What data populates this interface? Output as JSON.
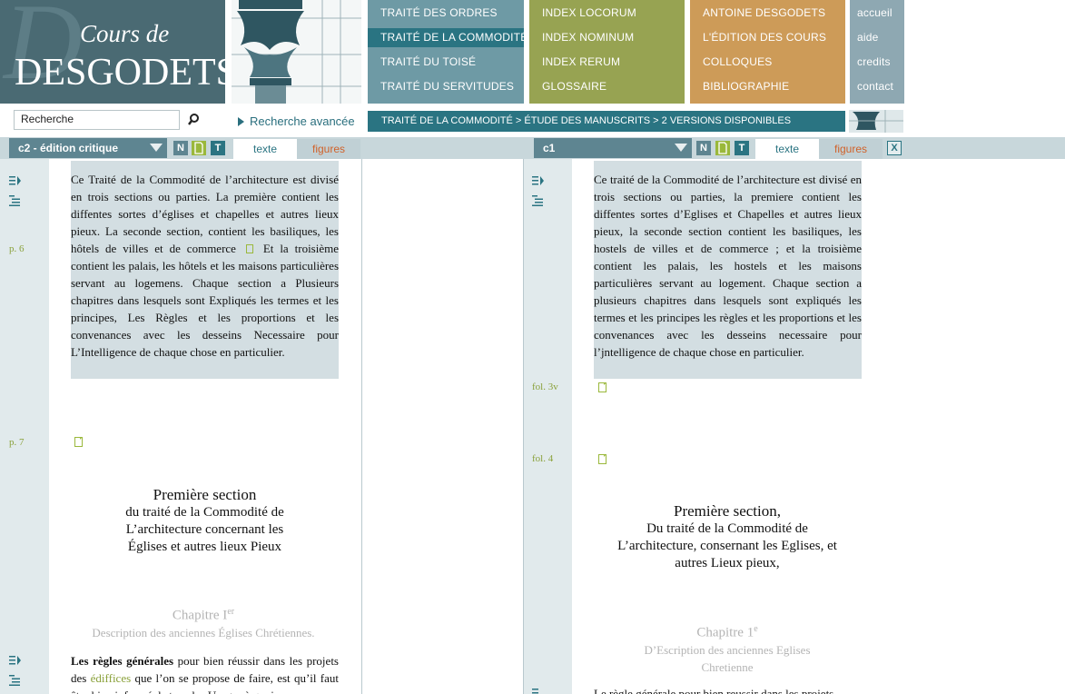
{
  "logo": {
    "line1": "Cours de",
    "line2": "DESGODETS",
    "bg_letter": "D"
  },
  "menu": {
    "col1": [
      "TRAITÉ DES ORDRES",
      "TRAITÉ DE LA COMMODITÉ",
      "TRAITÉ DU TOISÉ",
      "TRAITÉ DU SERVITUDES"
    ],
    "col2": [
      "INDEX LOCORUM",
      "INDEX NOMINUM",
      "INDEX RERUM",
      "GLOSSAIRE"
    ],
    "col3": [
      "ANTOINE DESGODETS",
      "L'ÉDITION DES COURS",
      "COLLOQUES",
      "BIBLIOGRAPHIE"
    ],
    "col4": [
      "accueil",
      "aide",
      "credits",
      "contact"
    ],
    "active": "TRAITÉ DE LA COMMODITÉ"
  },
  "search": {
    "value": "Recherche",
    "advanced": "Recherche avancée"
  },
  "breadcrumb": "TRAITÉ DE LA COMMODITÉ > ÉTUDE DES MANUSCRITS > 2 VERSIONS DISPONIBLES",
  "colors": {
    "teal": "#2a7482",
    "olive": "#97a352",
    "ochre": "#cd9b58",
    "grey_blue": "#8ea8b2",
    "green_label": "#8aa13a",
    "orange_tab": "#d0622a"
  },
  "left_panel": {
    "version": "c2 - édition critique",
    "btn_n": "N",
    "btn_t": "T",
    "tab_text": "texte",
    "tab_figures": "figures",
    "para1_a": "Ce Traité de la Commodité de l’architecture est divisé en trois sections ou parties. La première contient les diffentes sortes d’églises et chapelles et autres lieux pieux. La seconde section, contient les basiliques, les hôtels de villes et de commerce",
    "para1_b": "Et la troisième contient les palais, les hôtels et les maisons particulières servant au logemens. Chaque section a Plusieurs chapitres dans lesquels sont Expliqués les termes et les principes, Les Règles et les proportions et les convenances avec les desseins Necessaire pour L’Intelligence de chaque chose en particulier.",
    "page1": "p. 6",
    "page2": "p. 7",
    "section_title": "Première section",
    "section_sub1": "du traité de la Commodité de",
    "section_sub2": "L’architecture concernant les",
    "section_sub3": "Églises et autres lieux Pieux",
    "chapter": "Chapitre I",
    "chapter_sup": "er",
    "chapter_sub": "Description des anciennes Églises Chrétiennes.",
    "para2_bold": "Les règles générales",
    "para2_a": "pour bien réussir dans les projets des",
    "para2_green": "édiffices",
    "para2_b": "que l’on se propose de faire, est",
    "para2_c": "qu’il faut être bien informé de tous les Usages à quoi"
  },
  "right_panel": {
    "version": "c1",
    "btn_n": "N",
    "btn_t": "T",
    "btn_close": "X",
    "tab_text": "texte",
    "tab_figures": "figures",
    "para1": "Ce traité de la Commodité de l’architecture est divisé en trois sections ou parties, la premiere contient les diffentes sortes d’Eglises et Chapelles et autres lieux pieux, la seconde section contient les basiliques, les hostels de villes et de commerce ; et la troisième contient les palais, les hostels et les maisons particulières servant au logement. Chaque section a plusieurs chapitres dans lesquels sont expliqués les termes et les principes les règles et les proportions et les convenances avec les desseins necessaire pour l’jntelligence de chaque chose en particulier.",
    "fol1": "fol. 3v",
    "fol2": "fol. 4",
    "section_title": "Première section,",
    "section_sub1": "Du traité de la Commodité de",
    "section_sub2": "L’architecture, conser­nant les Eglises, et",
    "section_sub3": "autres Lieux pieux,",
    "chapter": "Chapitre 1",
    "chapter_sup": "e",
    "chapter_sub1": "D’Escription des anciennes Eglises",
    "chapter_sub2": "Chretienne",
    "para2": "Le règle générale pour bien reussir dans les projets"
  }
}
